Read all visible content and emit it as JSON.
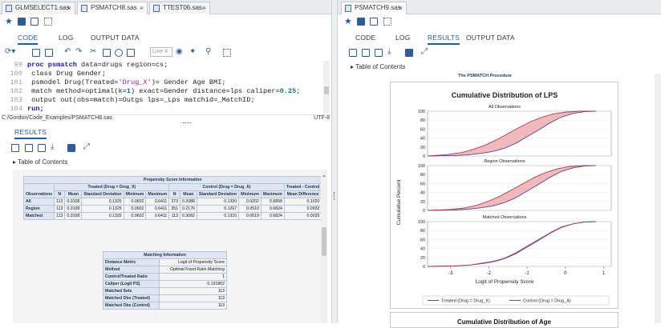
{
  "left": {
    "file_tabs": [
      {
        "label": "GLMSELECT1.sas",
        "active": false
      },
      {
        "label": "PSMATCH8.sas",
        "active": true
      },
      {
        "label": "TTEST06.sas",
        "active": false
      }
    ],
    "subtabs": [
      "CODE",
      "LOG",
      "OUTPUT DATA"
    ],
    "active_subtab": "CODE",
    "line_box_placeholder": "Line #",
    "code_lines": [
      {
        "n": "99",
        "html": "<span class='kw'>proc psmatch</span> data=drugs region=cs;"
      },
      {
        "n": "100",
        "html": "   class Drug Gender;"
      },
      {
        "n": "101",
        "html": "   psmodel Drug(Treated=<span class='str'>'Drug_X'</span>)= Gender Age BMI;"
      },
      {
        "n": "102",
        "html": "   match method=optimal(k=<span class='num'>1</span>) exact=Gender distance=lps caliper=<span class='num'>0.25</span>;"
      },
      {
        "n": "103",
        "html": "   output out(obs=match)=Outgs lps=_Lps matchid=_MatchID;"
      },
      {
        "n": "104",
        "html": "<span class='kw'>run;</span>"
      }
    ],
    "status_path": "C:/Gordon/Code_Examples/PSMATCH8.sas",
    "status_encoding": "UTF-8",
    "results_tab": "RESULTS",
    "toc_label": "Table of Contents"
  },
  "psi": {
    "title": "Propensity Score Information",
    "treated_header": "Treated (Drug = Drug_X)",
    "control_header": "Control (Drug = Drug_A)",
    "diff_header": "Treated - Control",
    "col_obs": "Observations",
    "cols": [
      "N",
      "Mean",
      "Standard Deviation",
      "Minimum",
      "Maximum"
    ],
    "diff_col": "Mean Difference",
    "rows": [
      {
        "label": "All",
        "t": [
          "113",
          "0.3108",
          "0.1325",
          "0.0602",
          "0.6411"
        ],
        "c": [
          "373",
          "0.2088",
          "0.1320",
          "0.0202",
          "0.6858"
        ],
        "d": "0.1020"
      },
      {
        "label": "Region",
        "t": [
          "113",
          "0.3108",
          "0.1325",
          "0.0602",
          "0.6411"
        ],
        "c": [
          "351",
          "0.2176",
          "0.1267",
          "0.0510",
          "0.6824"
        ],
        "d": "0.0932"
      },
      {
        "label": "Matched",
        "t": [
          "113",
          "0.3108",
          "0.1325",
          "0.0602",
          "0.6411"
        ],
        "c": [
          "113",
          "0.3082",
          "0.1310",
          "0.0619",
          "0.6824"
        ],
        "d": "0.0025"
      }
    ]
  },
  "mi": {
    "title": "Matching Information",
    "rows": [
      [
        "Distance Metric",
        "Logit of Propensity Score"
      ],
      [
        "Method",
        "Optimal Fixed Ratio Matching"
      ],
      [
        "Control/Treated Ratio",
        "1"
      ],
      [
        "Caliper (Logit PS)",
        "0.191862"
      ],
      [
        "Matched Sets",
        "113"
      ],
      [
        "Matched Obs (Treated)",
        "113"
      ],
      [
        "Matched Obs (Control)",
        "113"
      ]
    ]
  },
  "right": {
    "file_tabs": [
      {
        "label": "PSMATCH9.sas",
        "active": true
      }
    ],
    "subtabs": [
      "CODE",
      "LOG",
      "RESULTS",
      "OUTPUT DATA"
    ],
    "active_subtab": "RESULTS",
    "toc_label": "Table of Contents",
    "proc_caption": "The PSMATCH Procedure",
    "next_chart_title": "Cumulative Distribution of Age"
  },
  "chart_data": {
    "type": "line",
    "title": "Cumulative Distribution of LPS",
    "panels": [
      "All Observations",
      "Region Observations",
      "Matched Observations"
    ],
    "xlabel": "Logit of Propensity Score",
    "ylabel": "Cumulative Percent",
    "xlim": [
      -3.6,
      1.2
    ],
    "ylim": [
      0,
      100
    ],
    "xticks": [
      -3,
      -2,
      -1,
      0,
      1
    ],
    "yticks": [
      0,
      20,
      40,
      60,
      80,
      100
    ],
    "legend_position": "bottom",
    "series": [
      {
        "name": "Treated (Drug = Drug_X)",
        "color": "#4a4aa8",
        "x": [
          -3.6,
          -2.9,
          -2.5,
          -2.2,
          -1.9,
          -1.6,
          -1.3,
          -1.0,
          -0.7,
          -0.4,
          -0.1,
          0.2,
          0.5,
          0.8
        ],
        "values": [
          0,
          1,
          3,
          6,
          10,
          17,
          28,
          43,
          58,
          74,
          87,
          95,
          99,
          100
        ]
      },
      {
        "name": "Control (Drug = Drug_A)",
        "color": "#b04040",
        "x": [
          -3.6,
          -3.1,
          -2.7,
          -2.4,
          -2.1,
          -1.8,
          -1.5,
          -1.2,
          -0.9,
          -0.6,
          -0.3,
          0.0,
          0.4,
          0.8
        ],
        "values": [
          0,
          3,
          8,
          15,
          24,
          36,
          50,
          64,
          77,
          87,
          94,
          98,
          100,
          100
        ]
      },
      {
        "name": "Treated (Drug = Drug_X) Region",
        "color": "#4a4aa8",
        "x": [
          -3.6,
          -2.9,
          -2.5,
          -2.2,
          -1.9,
          -1.6,
          -1.3,
          -1.0,
          -0.7,
          -0.4,
          -0.1,
          0.2,
          0.5,
          0.8
        ],
        "values": [
          0,
          1,
          3,
          6,
          10,
          17,
          28,
          43,
          58,
          74,
          87,
          95,
          99,
          100
        ]
      },
      {
        "name": "Control (Drug = Drug_A) Region",
        "color": "#b04040",
        "x": [
          -3.6,
          -3.0,
          -2.6,
          -2.3,
          -2.0,
          -1.7,
          -1.4,
          -1.1,
          -0.8,
          -0.5,
          -0.2,
          0.1,
          0.5,
          0.8
        ],
        "values": [
          0,
          2,
          6,
          12,
          21,
          32,
          46,
          60,
          74,
          85,
          93,
          98,
          100,
          100
        ]
      },
      {
        "name": "Treated (Drug = Drug_X) Matched",
        "color": "#4a4aa8",
        "x": [
          -3.6,
          -2.9,
          -2.5,
          -2.2,
          -1.9,
          -1.6,
          -1.3,
          -1.0,
          -0.7,
          -0.4,
          -0.1,
          0.2,
          0.5,
          0.8
        ],
        "values": [
          0,
          1,
          3,
          6,
          10,
          17,
          28,
          43,
          58,
          74,
          87,
          95,
          99,
          100
        ]
      },
      {
        "name": "Control (Drug = Drug_A) Matched",
        "color": "#b04040",
        "x": [
          -3.6,
          -2.9,
          -2.5,
          -2.2,
          -1.9,
          -1.6,
          -1.3,
          -1.0,
          -0.7,
          -0.4,
          -0.1,
          0.2,
          0.5,
          0.8
        ],
        "values": [
          0,
          1,
          3,
          7,
          11,
          18,
          30,
          45,
          60,
          75,
          88,
          95,
          99,
          100
        ]
      }
    ],
    "legend": [
      "Treated (Drug = Drug_X)",
      "Control (Drug = Drug_A)"
    ]
  }
}
